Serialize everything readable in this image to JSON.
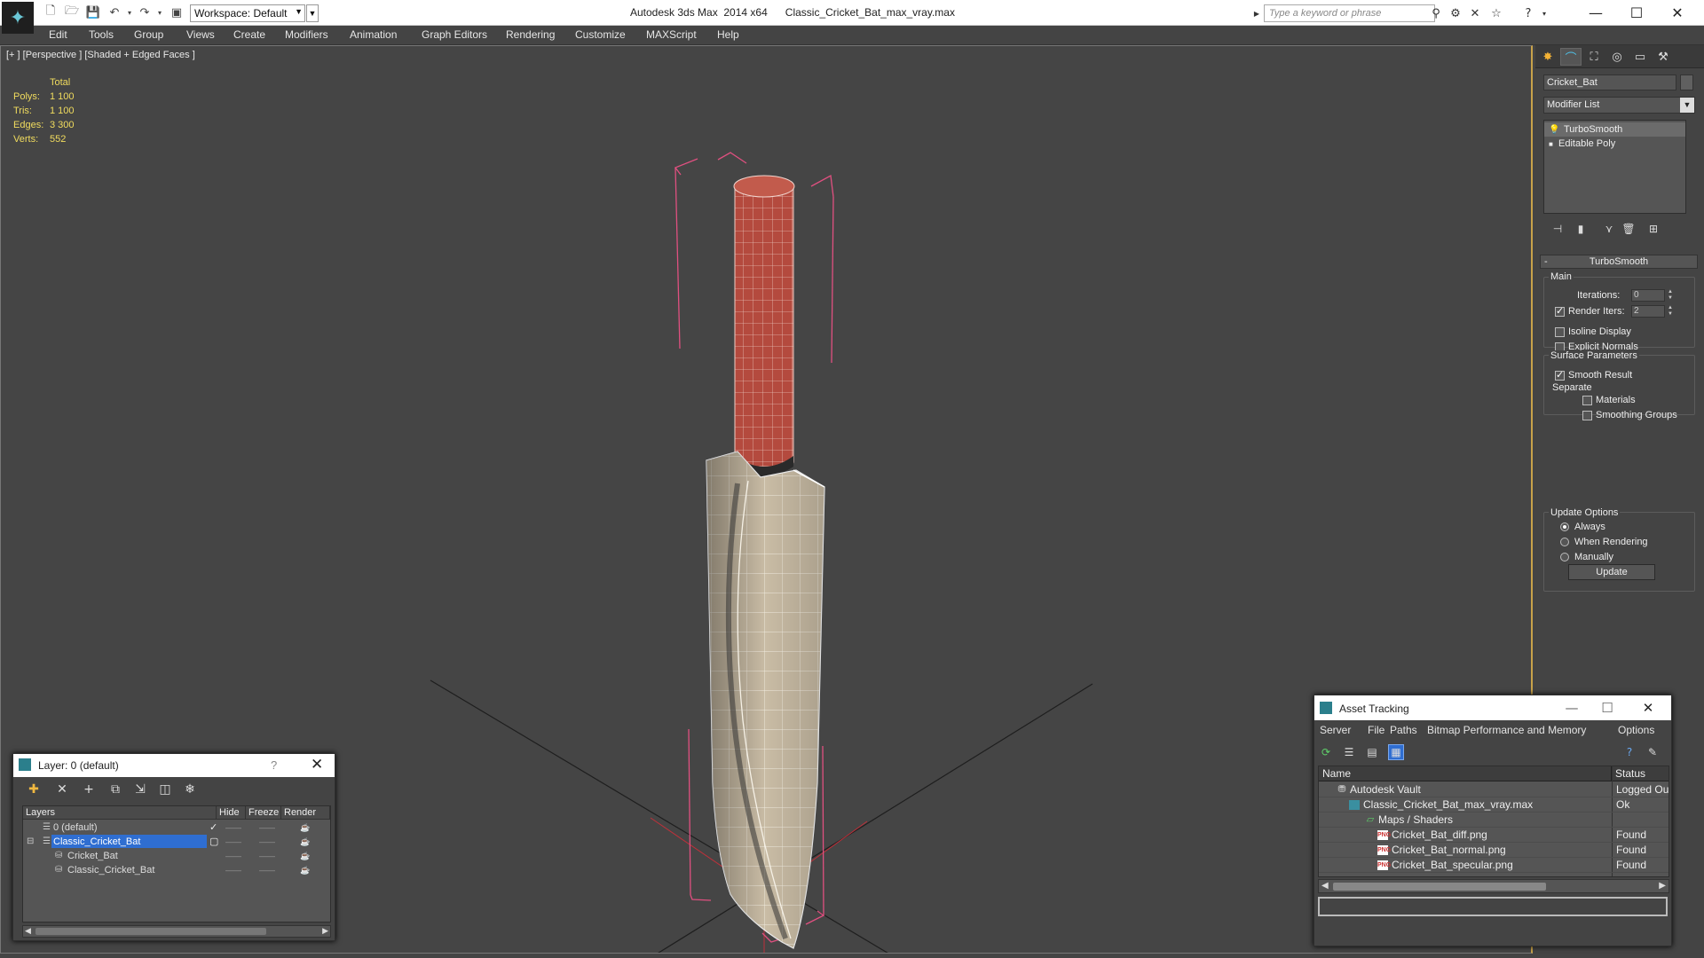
{
  "titlebar": {
    "app_title": "Autodesk 3ds Max  2014 x64",
    "file_name": "Classic_Cricket_Bat_max_vray.max",
    "workspace": "Workspace: Default",
    "search_placeholder": "Type a keyword or phrase",
    "logo_glyph": "✦"
  },
  "menu": [
    "Edit",
    "Tools",
    "Group",
    "Views",
    "Create",
    "Modifiers",
    "Animation",
    "Graph Editors",
    "Rendering",
    "Customize",
    "MAXScript",
    "Help"
  ],
  "viewport": {
    "label": "[+ ] [Perspective ] [Shaded + Edged Faces ]",
    "stats": {
      "header": "Total",
      "rows": [
        {
          "k": "Polys:",
          "v": "1 100"
        },
        {
          "k": "Tris:",
          "v": "1 100"
        },
        {
          "k": "Edges:",
          "v": "3 300"
        },
        {
          "k": "Verts:",
          "v": "552"
        }
      ]
    },
    "colors": {
      "background": "#454545",
      "handle": "#b44a3e",
      "blade": "#c8bba3",
      "bbox": "#e05080",
      "grid": "#1e1e1e"
    }
  },
  "command_panel": {
    "object_name": "Cricket_Bat",
    "modifier_list": "Modifier List",
    "stack": [
      "TurboSmooth",
      "Editable Poly"
    ],
    "rollout_title": "TurboSmooth",
    "main_label": "Main",
    "iterations_label": "Iterations:",
    "iterations_value": "0",
    "render_iters_label": "Render Iters:",
    "render_iters_value": "2",
    "render_iters_checked": true,
    "isoline_label": "Isoline Display",
    "explicit_normals_label": "Explicit Normals",
    "surface_params_label": "Surface Parameters",
    "smooth_result_label": "Smooth Result",
    "separate_label": "Separate",
    "materials_label": "Materials",
    "smoothing_groups_label": "Smoothing Groups",
    "update_options_label": "Update Options",
    "always_label": "Always",
    "when_rendering_label": "When Rendering",
    "manually_label": "Manually",
    "update_button": "Update"
  },
  "layer_window": {
    "title": "Layer: 0 (default)",
    "help": "?",
    "columns": [
      "Layers",
      "Hide",
      "Freeze",
      "Render"
    ],
    "rows": [
      {
        "name": "0 (default)",
        "indent": 0
      },
      {
        "name": "Classic_Cricket_Bat",
        "indent": 0
      },
      {
        "name": "Cricket_Bat",
        "indent": 1
      },
      {
        "name": "Classic_Cricket_Bat",
        "indent": 1
      }
    ]
  },
  "asset_window": {
    "title": "Asset Tracking",
    "menu": [
      "Server",
      "File",
      "Paths",
      "Bitmap Performance and Memory",
      "Options"
    ],
    "columns": [
      "Name",
      "Status"
    ],
    "rows": [
      {
        "name": "Autodesk Vault",
        "status": "Logged Ou",
        "icon": "vault"
      },
      {
        "name": "Classic_Cricket_Bat_max_vray.max",
        "status": "Ok",
        "icon": "max"
      },
      {
        "name": "Maps / Shaders",
        "status": "",
        "icon": "maps"
      },
      {
        "name": "Cricket_Bat_diff.png",
        "status": "Found",
        "icon": "png"
      },
      {
        "name": "Cricket_Bat_normal.png",
        "status": "Found",
        "icon": "png"
      },
      {
        "name": "Cricket_Bat_specular.png",
        "status": "Found",
        "icon": "png"
      }
    ],
    "png_badge": "PNG"
  }
}
